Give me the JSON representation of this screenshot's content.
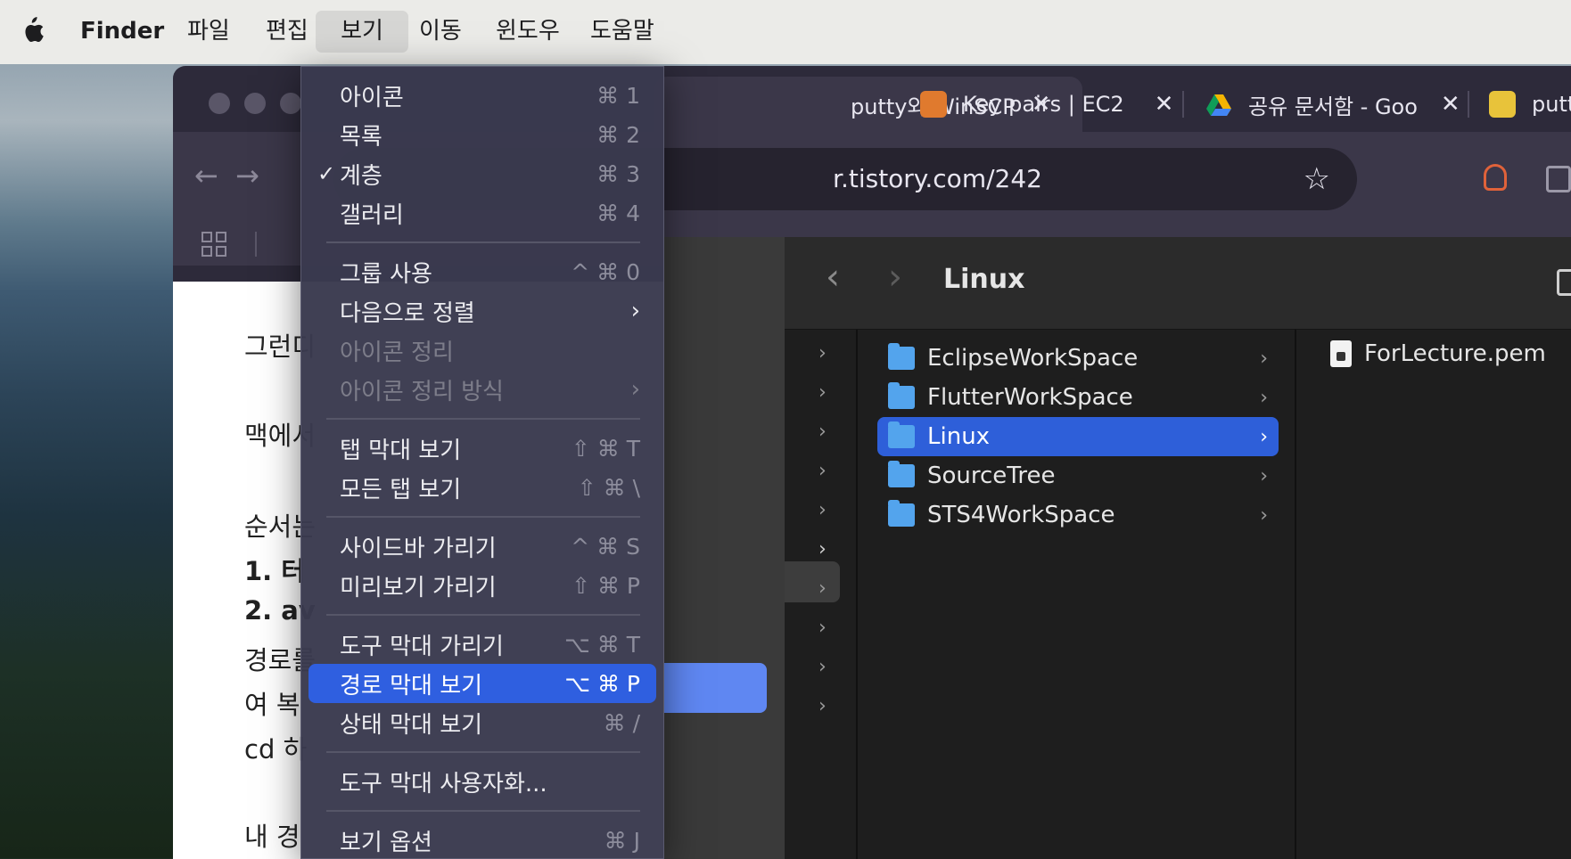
{
  "menubar": {
    "finder": "Finder",
    "items": [
      "파일",
      "편집",
      "보기",
      "이동",
      "윈도우",
      "도움말"
    ],
    "open_index": 2
  },
  "view_menu": {
    "items": [
      {
        "label": "아이콘",
        "shortcut": "⌘ 1"
      },
      {
        "label": "목록",
        "shortcut": "⌘ 2"
      },
      {
        "label": "계층",
        "shortcut": "⌘ 3",
        "checked": true,
        "check": "✓"
      },
      {
        "label": "갤러리",
        "shortcut": "⌘ 4"
      },
      {
        "label": "그룹 사용",
        "shortcut": "^ ⌘ 0"
      },
      {
        "label": "다음으로 정렬",
        "submenu": "›"
      },
      {
        "label": "아이콘 정리",
        "disabled": true
      },
      {
        "label": "아이콘 정리 방식",
        "disabled": true,
        "submenu": "›"
      },
      {
        "label": "탭 막대 보기",
        "shortcut": "⇧ ⌘ T"
      },
      {
        "label": "모든 탭 보기",
        "shortcut": "⇧ ⌘ \\"
      },
      {
        "label": "사이드바 가리기",
        "shortcut": "^ ⌘ S"
      },
      {
        "label": "미리보기 가리기",
        "shortcut": "⇧ ⌘ P"
      },
      {
        "label": "도구 막대 가리기",
        "shortcut": "⌥ ⌘ T"
      },
      {
        "label": "경로 막대 보기",
        "shortcut": "⌥ ⌘ P",
        "highlighted": true
      },
      {
        "label": "상태 막대 보기",
        "shortcut": "⌘ /"
      },
      {
        "label": "도구 막대 사용자화..."
      },
      {
        "label": "보기 옵션",
        "shortcut": "⌘ J"
      }
    ]
  },
  "browser": {
    "tabs": [
      {
        "title": "putty와 WinSCP",
        "close": "✕"
      },
      {
        "title": "Key pairs | EC2",
        "close": "✕",
        "favicon_color": "#e07a2e"
      },
      {
        "title": "공유 문서함 - Goo",
        "close": "✕",
        "favicon_color": "#f4b400"
      },
      {
        "title": "putt",
        "favicon_color": "#e8c33a"
      }
    ],
    "url": "r.tistory.com/242",
    "back_icon": "←",
    "forward_icon": "→",
    "star_icon": "☆"
  },
  "page_text": [
    "그런디",
    "맥에서",
    "순서는",
    "1. 터",
    "2. av",
    "경로를",
    "여 복",
    "cd 하",
    "내 경"
  ],
  "finder": {
    "title": "Linux",
    "back_icon": "‹",
    "forward_icon": "›",
    "folders": [
      "EclipseWorkSpace",
      "FlutterWorkSpace",
      "Linux",
      "SourceTree",
      "STS4WorkSpace"
    ],
    "selected_folder": "Linux",
    "files": [
      "ForLecture.pem"
    ],
    "chevron": "›"
  }
}
